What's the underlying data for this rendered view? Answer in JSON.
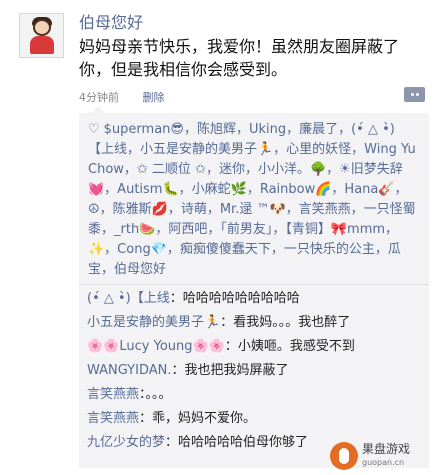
{
  "post": {
    "author": "伯母您好",
    "text": "妈妈母亲节快乐，我爱你！虽然朋友圈屏蔽了你，但是我相信你会感受到。",
    "time": "4分钟前",
    "delete_label": "删除"
  },
  "likes": {
    "names_text": "$uperman😎，陈旭辉，Uking，廉晨了，(•́ △ •̀)【上线，小五是安静的美男子🏃，心里的妖怪，Wing Yu Chow，✩ 二顺位 ✩，迷你，小小洋。🌳，☀旧梦失辞💓，Autism🐛，小麻蛇🌿，Rainbow🌈，Hana🎸，☮，陈雅斯💋，诗萌，Mr.逯 ™🐶，言笑燕燕，一只怪蜀黍，_rth🍉，阿西吧，「前男友」，【青铜】🎀mmm，✨，Cong💎，痴痴傻傻蠢天下，一只快乐的公主，瓜宝，伯母您好"
  },
  "comments": [
    {
      "who": "(•́ △ •̀)【上线",
      "text": "：哈哈哈哈哈哈哈哈哈"
    },
    {
      "who": "小五是安静的美男子🏃",
      "text": "：看我妈。。。我也醉了"
    },
    {
      "who": "🌸🌸Lucy Young🌸🌸",
      "text": "：小姨咂。我感受不到"
    },
    {
      "who": "WANGYIDAN.",
      "text": "：我也把我妈屏蔽了"
    },
    {
      "who": "言笑燕燕",
      "text": "：。。。"
    },
    {
      "who": "言笑燕燕",
      "text": "：乖，妈妈不爱你。"
    },
    {
      "who": "九亿少女的梦",
      "text": "：哈哈哈哈哈伯母你够了"
    }
  ],
  "watermark": {
    "title": "果盘游戏",
    "sub": "guopan.cn"
  },
  "colors": {
    "link": "#576b95",
    "comment_bg": "#f3f3f5"
  }
}
